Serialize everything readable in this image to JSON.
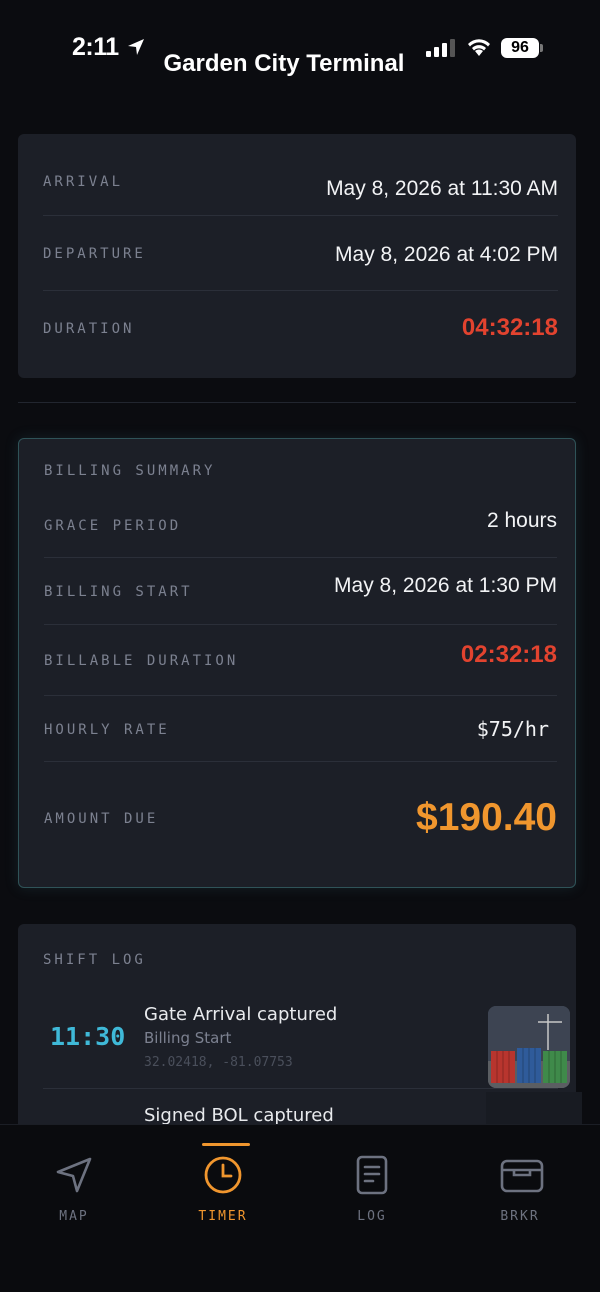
{
  "status_bar": {
    "time": "2:11",
    "battery": "96"
  },
  "header": {
    "title": "Garden City Terminal"
  },
  "times": {
    "arrival_label": "ARRIVAL",
    "arrival_value": "May 8, 2026 at 11:30 AM",
    "departure_label": "DEPARTURE",
    "departure_value": "May 8, 2026 at 4:02 PM",
    "duration_label": "DURATION",
    "duration_value": "04:32:18"
  },
  "billing": {
    "title": "BILLING SUMMARY",
    "grace_label": "GRACE PERIOD",
    "grace_value": "2 hours",
    "start_label": "BILLING START",
    "start_value": "May 8, 2026 at 1:30 PM",
    "billable_label": "BILLABLE DURATION",
    "billable_value": "02:32:18",
    "rate_label": "HOURLY RATE",
    "rate_value": "$75/hr",
    "amount_label": "AMOUNT DUE",
    "amount_value": "$190.40"
  },
  "shift_log": {
    "title": "SHIFT LOG",
    "entries": [
      {
        "time": "11:30",
        "event": "Gate Arrival captured",
        "sub": "Billing Start",
        "coords": "32.02418, -81.07753",
        "thumbnail": "container-yard-photo"
      },
      {
        "event": "Signed BOL captured"
      }
    ]
  },
  "tabs": [
    {
      "label": "MAP",
      "icon": "navigation-arrow-icon"
    },
    {
      "label": "TIMER",
      "icon": "clock-icon",
      "active": true
    },
    {
      "label": "LOG",
      "icon": "document-icon"
    },
    {
      "label": "BRKR",
      "icon": "wallet-card-icon"
    }
  ],
  "colors": {
    "accent": "#f0962e",
    "alert": "#e2432f",
    "log_time": "#3fb9d8",
    "card": "#1c1f27"
  }
}
